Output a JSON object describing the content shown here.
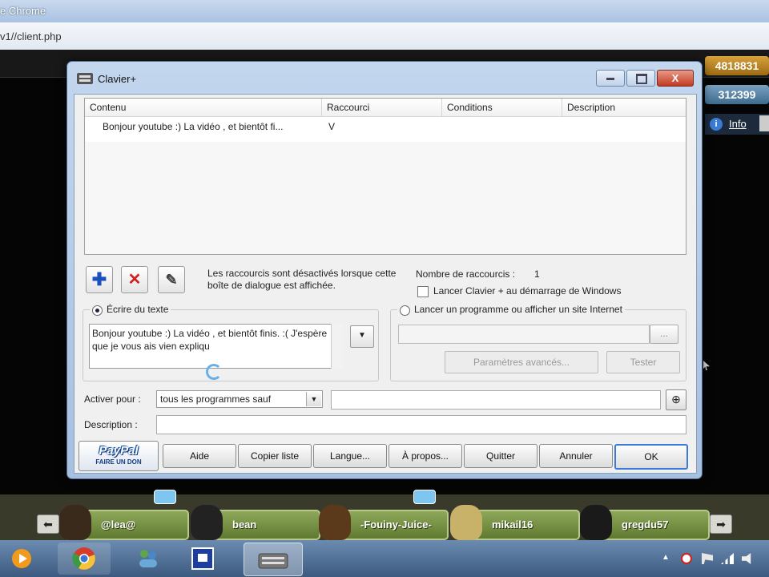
{
  "browser": {
    "title": "e Chrome",
    "address": "v1//client.php"
  },
  "game": {
    "credits": "4818831",
    "pixels": "312399",
    "info_link": "Info",
    "friends": [
      {
        "name": "@lea@",
        "color": "#3a2a1c"
      },
      {
        "name": "bean",
        "color": "#222222"
      },
      {
        "name": "-Fouiny-Juice-",
        "color": "#5a3a1a"
      },
      {
        "name": "mikail16",
        "color": "#c8b26a"
      },
      {
        "name": "gregdu57",
        "color": "#1a1a1a"
      }
    ]
  },
  "dialog": {
    "title": "Clavier+",
    "close_symbol": "X",
    "columns": [
      "Contenu",
      "Raccourci",
      "Conditions",
      "Description"
    ],
    "rows": [
      {
        "contenu": "Bonjour youtube :) La vidéo , et bientôt fi...",
        "raccourci": "V",
        "conditions": "",
        "description": ""
      }
    ],
    "toolbar": {
      "add": "✚",
      "delete": "✕",
      "edit": "✎"
    },
    "info_note": "Les raccourcis sont désactivés lorsque cette boîte de dialogue est affichée.",
    "shortcut_count_label": "Nombre de raccourcis :",
    "shortcut_count": "1",
    "startup_label": "Lancer Clavier + au démarrage de Windows",
    "write_group_label": "Écrire du texte",
    "text_value": "Bonjour youtube :) La vidéo , et bientôt finis. :( J'espère que je vous ais vien expliqu",
    "program_group_label": "Lancer un programme ou afficher un site Internet",
    "browse_label": "...",
    "advanced_label": "Paramètres avancés...",
    "test_label": "Tester",
    "activate_label": "Activer pour :",
    "activate_value": "tous les programmes sauf",
    "description_label": "Description :",
    "paypal_logo": "PayPal",
    "paypal_sub": "FAIRE UN DON",
    "buttons": {
      "help": "Aide",
      "copy_list": "Copier liste",
      "language": "Langue...",
      "about": "À propos...",
      "quit": "Quitter",
      "cancel": "Annuler",
      "ok": "OK"
    }
  }
}
